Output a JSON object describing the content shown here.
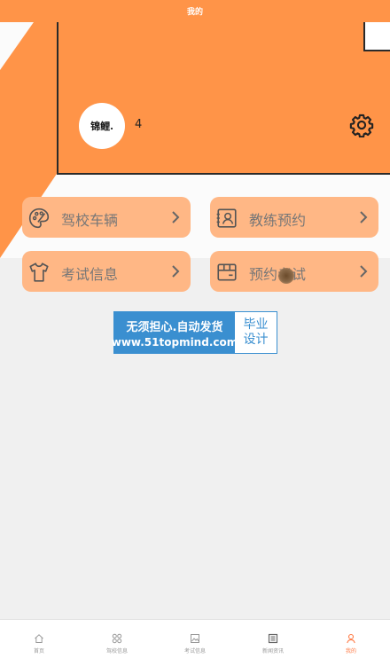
{
  "header": {
    "title": "我的"
  },
  "profile": {
    "avatar_text": "锦鲤.",
    "username": "4",
    "settings_icon": "gear-icon"
  },
  "menu": [
    {
      "label": "驾校车辆",
      "icon": "palette-icon"
    },
    {
      "label": "教练预约",
      "icon": "id-card-icon"
    },
    {
      "label": "考试信息",
      "icon": "shirt-icon"
    },
    {
      "label": "预约考试",
      "icon": "package-icon"
    }
  ],
  "watermark": {
    "line1": "无须担心.自动发货",
    "line2": "www.51topmind.com",
    "badge1": "毕业",
    "badge2": "设计"
  },
  "tabs": [
    {
      "label": "首页",
      "icon": "home-icon",
      "active": false
    },
    {
      "label": "驾校信息",
      "icon": "grid-icon",
      "active": false
    },
    {
      "label": "考试信息",
      "icon": "image-icon",
      "active": false
    },
    {
      "label": "新闻资讯",
      "icon": "newspaper-icon",
      "active": false
    },
    {
      "label": "我的",
      "icon": "person-icon",
      "active": true
    }
  ],
  "colors": {
    "accent": "#ff9448",
    "card": "#ffb785",
    "active_tab": "#ff7a45"
  }
}
